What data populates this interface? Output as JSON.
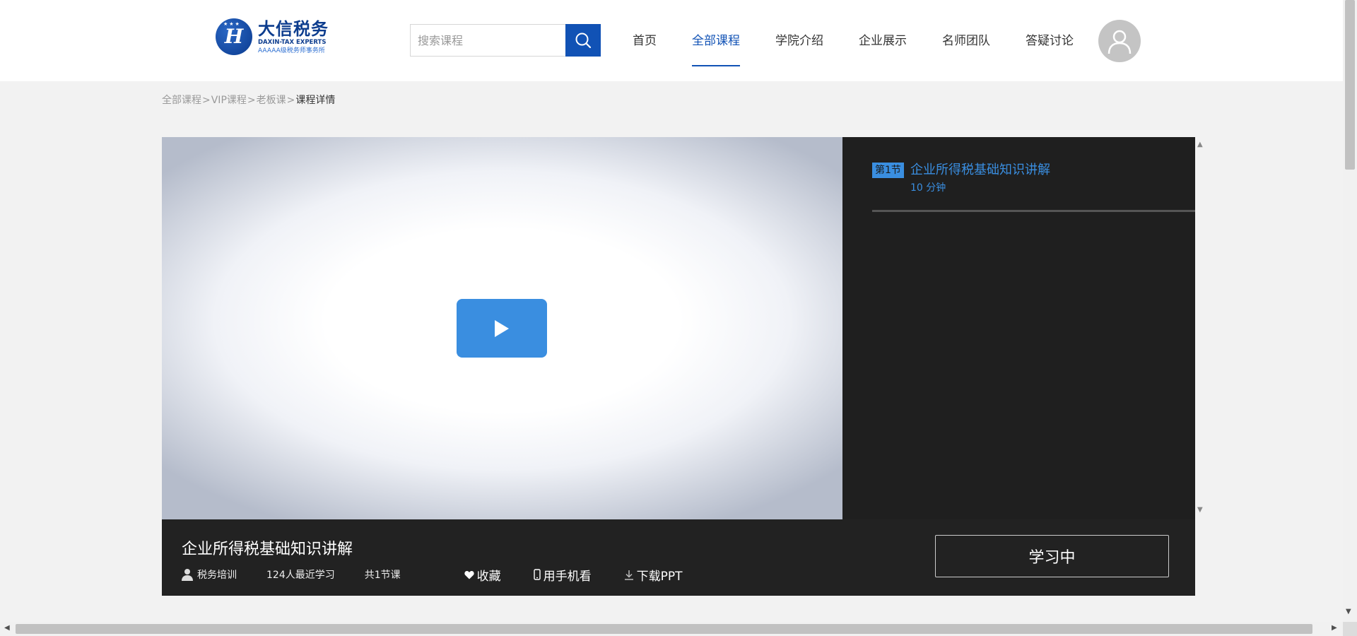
{
  "header": {
    "logo": {
      "name_cn": "大信税务",
      "name_en": "DAXIN-TAX  EXPERTS",
      "tagline": "AAAAA级税务师事务所"
    },
    "search": {
      "placeholder": "搜索课程",
      "value": ""
    },
    "nav": [
      {
        "label": "首页",
        "active": false
      },
      {
        "label": "全部课程",
        "active": true
      },
      {
        "label": "学院介绍",
        "active": false
      },
      {
        "label": "企业展示",
        "active": false
      },
      {
        "label": "名师团队",
        "active": false
      },
      {
        "label": "答疑讨论",
        "active": false
      }
    ]
  },
  "breadcrumb": {
    "items": [
      "全部课程",
      "VIP课程",
      "老板课"
    ],
    "separator": ">",
    "current": "课程详情"
  },
  "chapters": [
    {
      "badge": "第1节",
      "title": "企业所得税基础知识讲解",
      "duration": "10 分钟"
    }
  ],
  "course": {
    "title": "企业所得税基础知识讲解",
    "teacher": "税务培训",
    "learners": "124人最近学习",
    "lessons": "共1节课",
    "actions": {
      "favorite": "收藏",
      "mobile": "用手机看",
      "download": "下载PPT"
    },
    "study_button": "学习中"
  },
  "colors": {
    "brand": "#1152b5",
    "accent": "#3a8ee0",
    "dark_panel": "#1f1f1f"
  },
  "icons": [
    "search-icon",
    "user-avatar-icon",
    "play-icon",
    "person-icon",
    "heart-icon",
    "phone-icon",
    "download-icon"
  ]
}
